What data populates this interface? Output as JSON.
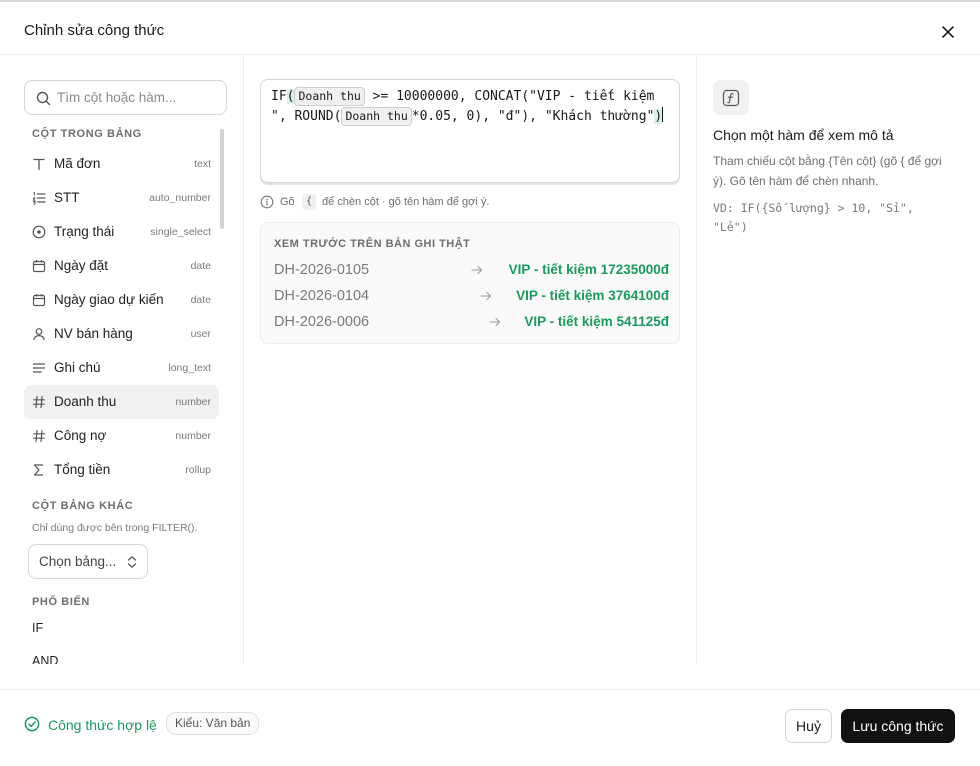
{
  "dialog": {
    "title": "Chỉnh sửa công thức"
  },
  "sidebar": {
    "search_placeholder": "Tìm cột hoặc hàm...",
    "section_table_columns": "CỘT TRONG BẢNG",
    "columns": [
      {
        "name": "Mã đơn",
        "type": "text",
        "icon": "text-icon"
      },
      {
        "name": "STT",
        "type": "auto_number",
        "icon": "numbered-list-icon"
      },
      {
        "name": "Trạng thái",
        "type": "single_select",
        "icon": "radio-circle-icon"
      },
      {
        "name": "Ngày đặt",
        "type": "date",
        "icon": "calendar-icon"
      },
      {
        "name": "Ngày giao dự kiến",
        "type": "date",
        "icon": "calendar-icon"
      },
      {
        "name": "NV bán hàng",
        "type": "user",
        "icon": "user-icon"
      },
      {
        "name": "Ghi chú",
        "type": "long_text",
        "icon": "long-text-icon"
      },
      {
        "name": "Doanh thu",
        "type": "number",
        "icon": "hash-icon"
      },
      {
        "name": "Công nợ",
        "type": "number",
        "icon": "hash-icon"
      },
      {
        "name": "Tổng tiền",
        "type": "rollup",
        "icon": "sigma-icon"
      }
    ],
    "section_other_tables": "CỘT BẢNG KHÁC",
    "other_tables_note": "Chỉ dùng được bên trong FILTER().",
    "table_select_value": "Chọn bảng...",
    "section_popular": "PHỔ BIẾN",
    "popular": [
      "IF",
      "AND"
    ]
  },
  "editor": {
    "part1": "IF",
    "paren_open": "(",
    "chip1": "Doanh thu",
    "part2": " >= 10000000, CONCAT(\"VIP - tiết kiệm \", ROUND(",
    "chip2": "Doanh thu",
    "part3": "*0.05, 0), \"đ\"), \"Khách thường\"",
    "paren_close": ")"
  },
  "hint": {
    "before": "Gõ",
    "key": "{",
    "after": "để chèn cột · gõ tên hàm để gợi ý."
  },
  "preview": {
    "label": "XEM TRƯỚC TRÊN BẢN GHI THẬT",
    "rows": [
      {
        "id": "DH-2026-0105",
        "result": "VIP - tiết kiệm 17235000đ"
      },
      {
        "id": "DH-2026-0104",
        "result": "VIP - tiết kiệm 3764100đ"
      },
      {
        "id": "DH-2026-0006",
        "result": "VIP - tiết kiệm 541125đ"
      }
    ]
  },
  "help": {
    "title": "Chọn một hàm để xem mô tả",
    "description": "Tham chiếu cột bằng {Tên cột} (gõ { để gợi ý). Gõ tên hàm để chèn nhanh.",
    "example": "VD: IF({Số lượng} > 10, \"Sỉ\", \"Lẻ\")"
  },
  "footer": {
    "status": "Công thức hợp lệ",
    "type_badge": "Kiểu: Văn bản",
    "cancel_label": "Huỷ",
    "save_label": "Lưu công thức"
  },
  "colors": {
    "accent_green": "#1a9a5c",
    "primary_button": "#111111"
  }
}
